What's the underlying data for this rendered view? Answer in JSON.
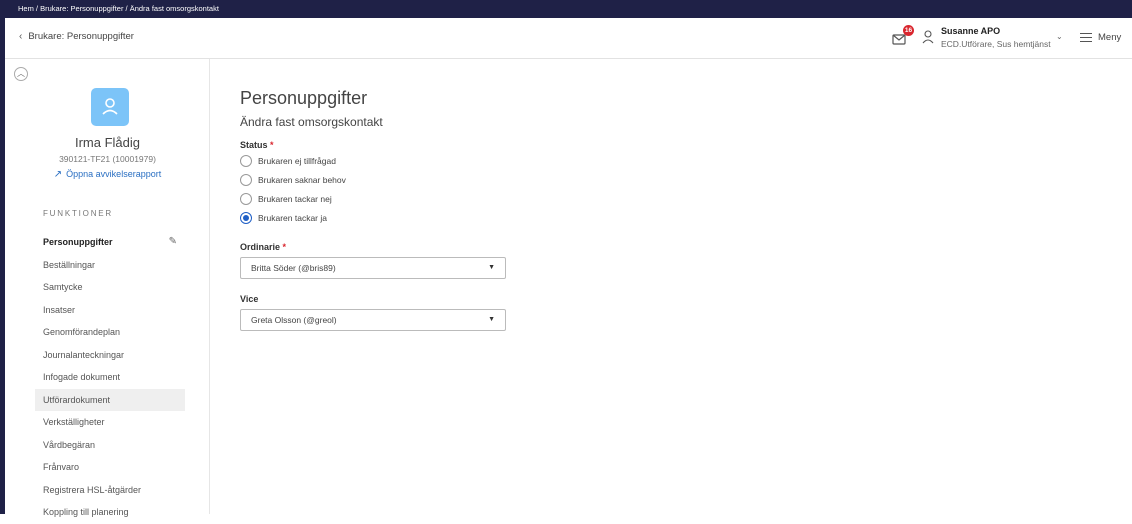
{
  "breadcrumb": "Hem / Brukare: Personuppgifter / Ändra fast omsorgskontakt",
  "topbar": {
    "back_label": "Brukare: Personuppgifter",
    "mail_count": "16",
    "user_name": "Susanne APO",
    "user_role": "ECD.Utförare, Sus hemtjänst",
    "menu_label": "Meny"
  },
  "sidebar": {
    "patient_name": "Irma Flådig",
    "patient_id": "390121-TF21 (10001979)",
    "report_link": "Öppna avvikelserapport",
    "section_title": "FUNKTIONER",
    "items": [
      {
        "label": "Personuppgifter"
      },
      {
        "label": "Beställningar"
      },
      {
        "label": "Samtycke"
      },
      {
        "label": "Insatser"
      },
      {
        "label": "Genomförandeplan"
      },
      {
        "label": "Journalanteckningar"
      },
      {
        "label": "Infogade dokument"
      },
      {
        "label": "Utförardokument"
      },
      {
        "label": "Verkställigheter"
      },
      {
        "label": "Vårdbegäran"
      },
      {
        "label": "Frånvaro"
      },
      {
        "label": "Registrera HSL-åtgärder"
      },
      {
        "label": "Koppling till planering"
      }
    ]
  },
  "form": {
    "title": "Personuppgifter",
    "subtitle": "Ändra fast omsorgskontakt",
    "status_label": "Status",
    "required_mark": "*",
    "status_options": [
      {
        "label": "Brukaren ej tillfrågad"
      },
      {
        "label": "Brukaren saknar behov"
      },
      {
        "label": "Brukaren tackar nej"
      },
      {
        "label": "Brukaren tackar ja"
      }
    ],
    "status_selected": "Brukaren tackar ja",
    "ordinarie_label": "Ordinarie",
    "ordinarie_value": "Britta Söder (@bris89)",
    "vice_label": "Vice",
    "vice_value": "Greta Olsson (@greol)"
  },
  "colors": {
    "header_bg": "#1f2147",
    "accent": "#1f5fc6",
    "badge": "#d9262e",
    "avatar": "#7cc4f8",
    "link": "#2a6fc2"
  }
}
